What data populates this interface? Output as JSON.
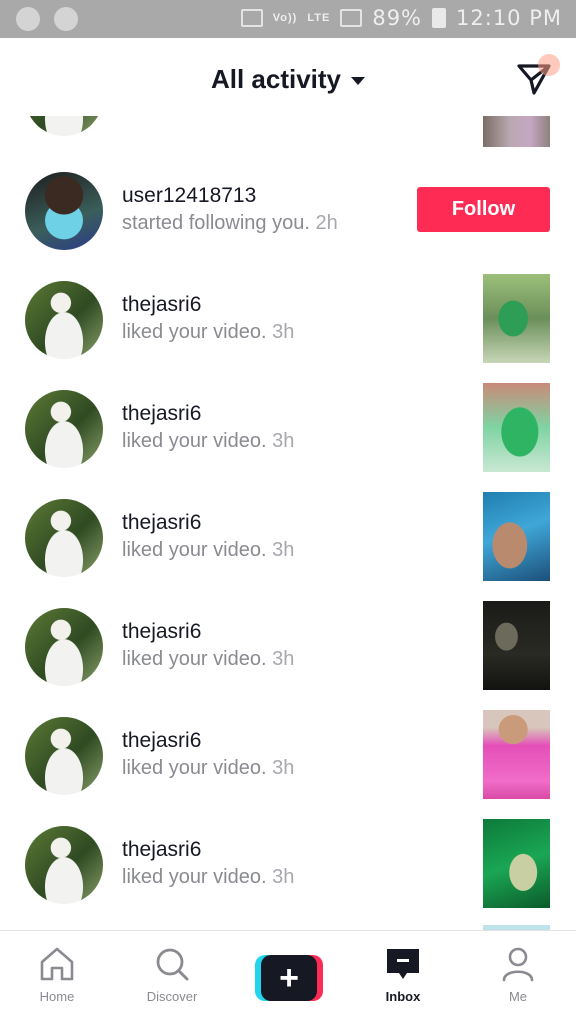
{
  "status_bar": {
    "network_labels": [
      "Vo))",
      "LTE",
      "LTE"
    ],
    "battery": "89%",
    "time": "12:10 PM"
  },
  "header": {
    "title": "All activity",
    "dropdown_icon": "caret-down-icon",
    "send_icon": "send-icon"
  },
  "notifications": [
    {
      "username": "user12418713",
      "action": "started following you.",
      "time": "2h",
      "button": "Follow"
    },
    {
      "username": "thejasri6",
      "action": "liked your video.",
      "time": "3h"
    },
    {
      "username": "thejasri6",
      "action": "liked your video.",
      "time": "3h"
    },
    {
      "username": "thejasri6",
      "action": "liked your video.",
      "time": "3h"
    },
    {
      "username": "thejasri6",
      "action": "liked your video.",
      "time": "3h"
    },
    {
      "username": "thejasri6",
      "action": "liked your video.",
      "time": "3h"
    },
    {
      "username": "thejasri6",
      "action": "liked your video.",
      "time": "3h"
    }
  ],
  "nav": {
    "home": "Home",
    "discover": "Discover",
    "create_icon": "plus-icon",
    "inbox": "Inbox",
    "me": "Me",
    "active": "Inbox"
  },
  "colors": {
    "follow_button": "#fe2c55",
    "text_primary": "#161823",
    "text_secondary": "#8a8b91",
    "accent_cyan": "#20d5ec"
  }
}
